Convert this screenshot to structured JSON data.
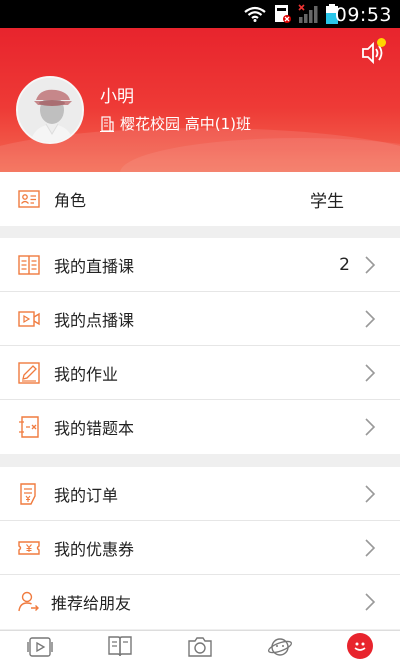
{
  "status_bar": {
    "time": "09:53"
  },
  "profile": {
    "name": "小明",
    "school": "樱花校园 高中(1)班"
  },
  "role_row": {
    "label": "角色",
    "value": "学生"
  },
  "courses": [
    {
      "label": "我的直播课",
      "badge": "2",
      "icon": "live-course-icon"
    },
    {
      "label": "我的点播课",
      "icon": "video-course-icon"
    },
    {
      "label": "我的作业",
      "icon": "homework-icon"
    },
    {
      "label": "我的错题本",
      "icon": "wrong-questions-icon"
    }
  ],
  "shopping": [
    {
      "label": "我的订单",
      "icon": "order-icon"
    },
    {
      "label": "我的优惠券",
      "icon": "coupon-icon"
    },
    {
      "label": "推荐给朋友",
      "icon": "recommend-friend-icon"
    }
  ],
  "tabs": [
    "video-tab-icon",
    "book-tab-icon",
    "camera-tab-icon",
    "planet-tab-icon",
    "me-tab-icon"
  ],
  "colors": {
    "brand": "#e8242d",
    "accent_icon": "#f07b3f",
    "chevron": "#999999"
  }
}
